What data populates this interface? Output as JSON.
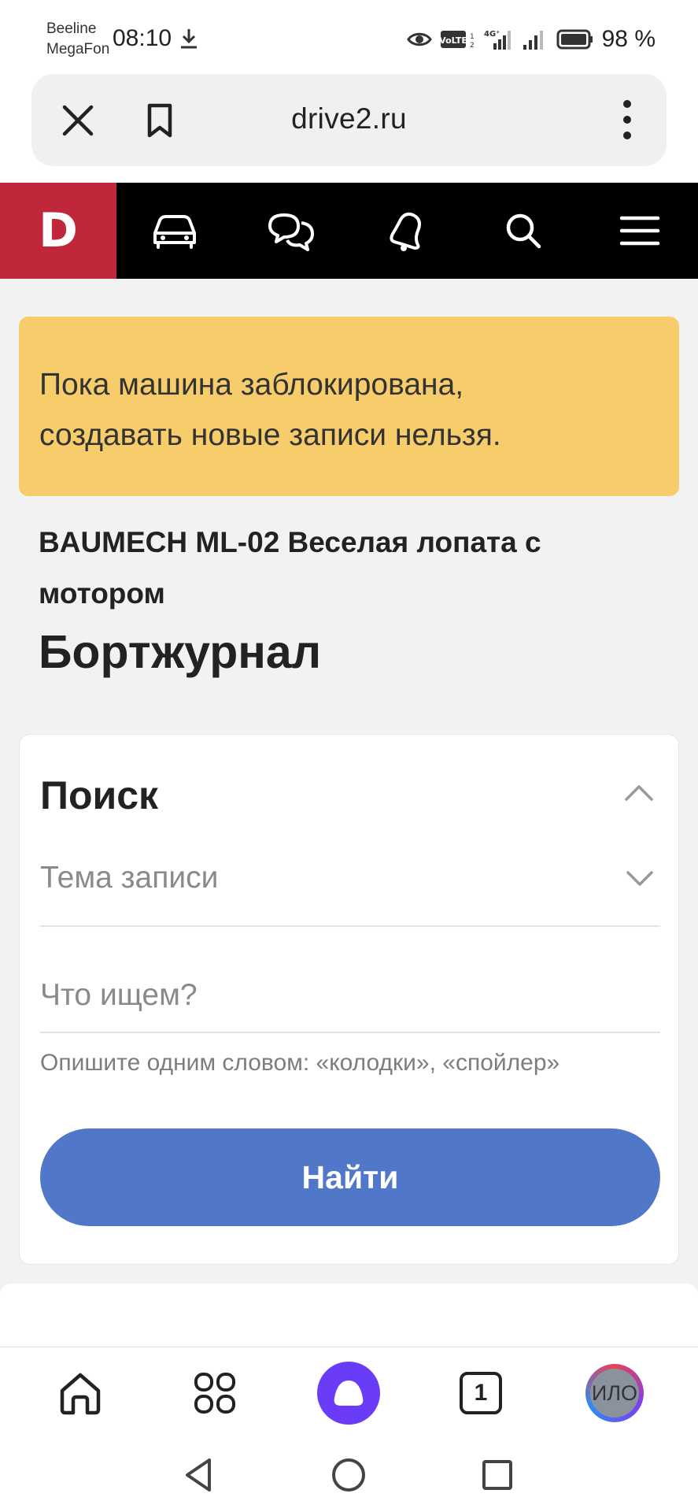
{
  "status_bar": {
    "carrier1": "Beeline",
    "carrier2": "MegaFon",
    "time": "08:10",
    "battery_percent": "98 %"
  },
  "address_bar": {
    "url": "drive2.ru",
    "icons": [
      "close-icon",
      "bookmark-icon",
      "more-vert-icon"
    ]
  },
  "site_nav": {
    "logo": "D",
    "logo_color": "#c0273a",
    "icons": [
      "car-icon",
      "chat-icon",
      "bell-icon",
      "search-icon",
      "menu-icon"
    ]
  },
  "alert": {
    "message_line1": "Пока машина заблокирована,",
    "message_line2": "создавать новые записи нельзя.",
    "background": "#f6cd6a"
  },
  "breadcrumb": "BAUMECH ML-02 Веселая лопата с мотором",
  "page_title": "Бортжурнал",
  "search": {
    "title": "Поиск",
    "topic_placeholder": "Тема записи",
    "query_placeholder": "Что ищем?",
    "hint": "Опишите одним словом: «колодки», «спойлер»",
    "submit_label": "Найти",
    "button_color": "#5077c8"
  },
  "browser_bar": {
    "tabs_count": "1",
    "avatar_text": "ИЛО",
    "icons": [
      "home-icon",
      "apps-grid-icon",
      "alice-icon",
      "tabs-icon",
      "avatar"
    ]
  },
  "system_nav": {
    "icons": [
      "back-icon",
      "home-circle-icon",
      "recents-icon"
    ]
  }
}
